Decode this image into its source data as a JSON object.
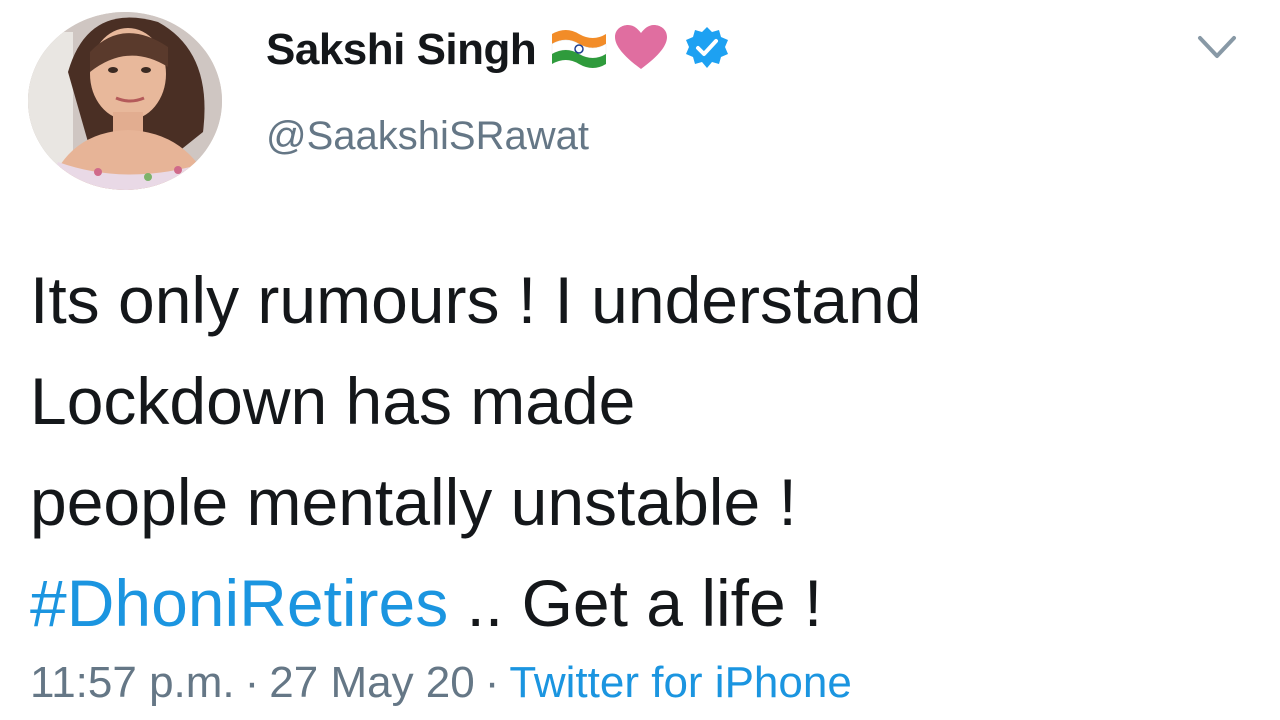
{
  "tweet": {
    "author": {
      "display_name": "Sakshi Singh",
      "handle": "@SaakshiSRawat",
      "verified": true,
      "name_emojis": [
        "india-flag-icon",
        "pink-heart-icon"
      ]
    },
    "text_lines": [
      "Its only rumours ! I understand",
      "Lockdown has made",
      "people mentally unstable !"
    ],
    "hashtag": "#DhoniRetires",
    "text_suffix": " .. Get a life !",
    "meta": {
      "time": "11:57 p.m.",
      "separator": "·",
      "date": "27 May 20",
      "source": "Twitter for iPhone"
    }
  },
  "colors": {
    "text": "#14171a",
    "secondary": "#657786",
    "link": "#1b95e0",
    "verified": "#1da1f2",
    "heart": "#e06ea0"
  }
}
